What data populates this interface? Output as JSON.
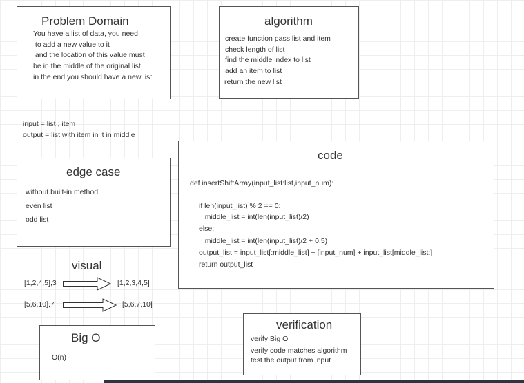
{
  "problem": {
    "title": "Problem Domain",
    "lines": [
      "You have a list of data, you need",
      " to add a new value to it",
      " and the location of this value must",
      "be in the middle of the original list,",
      "in the end you should have a new list"
    ]
  },
  "algorithm": {
    "title": "algorithm",
    "lines": [
      "create function pass list and item",
      "check length of list",
      "find the middle index to list",
      "add an item to list",
      "return the new list"
    ]
  },
  "io": {
    "input": "input = list , item",
    "output": "output = list with item in it in middle"
  },
  "edge": {
    "title": "edge case",
    "lines": [
      "without built-in method",
      "even list",
      "odd list"
    ]
  },
  "code": {
    "title": "code",
    "signature": "def insertShiftArray(input_list:list,input_num):",
    "lines": [
      "if len(input_list) % 2 == 0:",
      "   middle_list = int(len(input_list)/2)",
      "else:",
      "   middle_list = int(len(input_list)/2 + 0.5)",
      "output_list = input_list[:middle_list] + [input_num] + input_list[middle_list:]",
      "return output_list"
    ]
  },
  "visual": {
    "title": "visual",
    "rows": [
      {
        "from": "[1,2,4,5],3",
        "to": "[1,2,3,4,5]"
      },
      {
        "from": "[5,6,10],7",
        "to": "[5,6,7,10]"
      }
    ]
  },
  "bigo": {
    "title": "Big O",
    "value": "O(n)"
  },
  "verification": {
    "title": "verification",
    "lines": [
      "verify Big O",
      "verify code matches algorithm",
      "test the output from input"
    ]
  }
}
